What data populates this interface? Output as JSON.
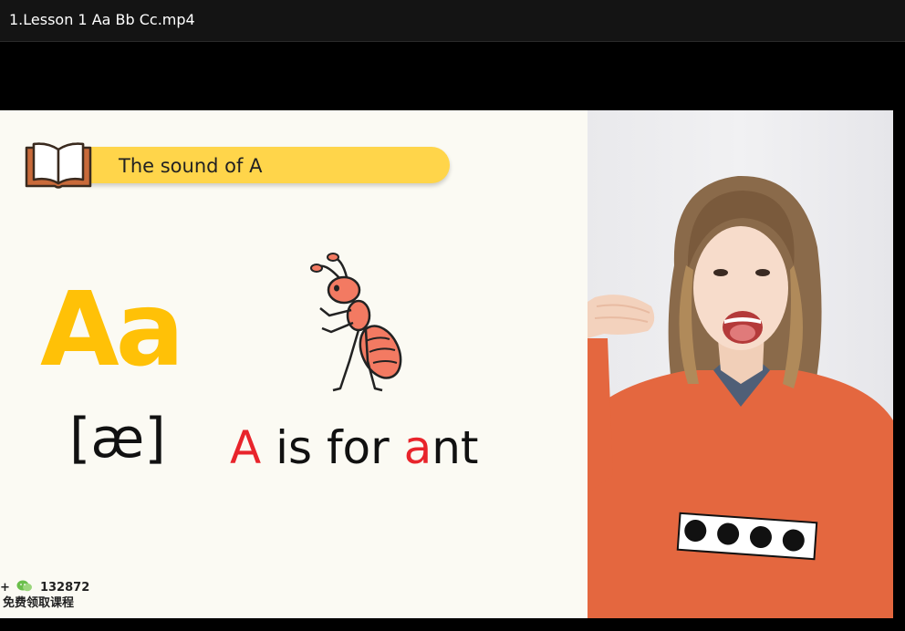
{
  "window": {
    "title": "1.Lesson 1 Aa Bb Cc.mp4"
  },
  "slide": {
    "banner_text": "The sound of A",
    "letter": "Aa",
    "phonetic": "[æ]",
    "phrase": {
      "part1": "A",
      "part2": " is for ",
      "part3": "a",
      "part4": "nt"
    },
    "watermark": {
      "prefix": "+",
      "number": "132872",
      "caption": "免费领取课程"
    }
  },
  "colors": {
    "banner": "#ffd54a",
    "letter": "#ffc107",
    "highlight": "#e8242b",
    "ant": "#f37a62",
    "sweater": "#e4673f"
  },
  "icons": {
    "book": "open-book-icon",
    "ant": "ant-illustration",
    "wechat": "wechat-icon"
  }
}
